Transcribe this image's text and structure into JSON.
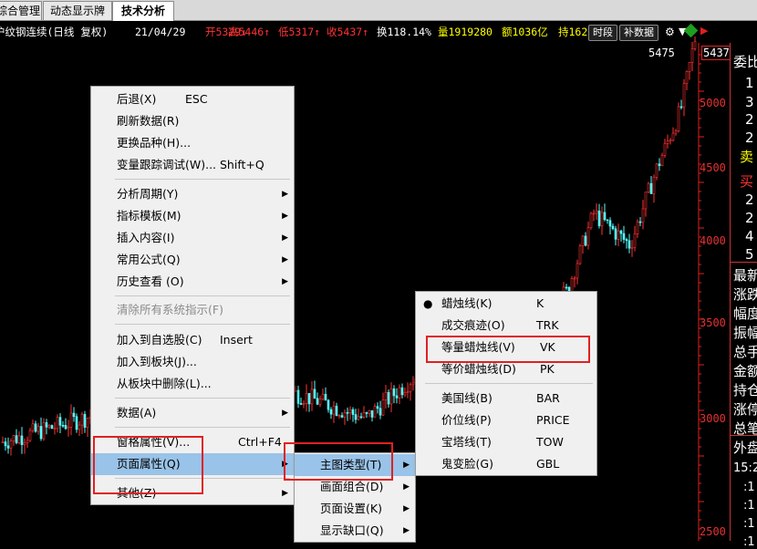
{
  "tabs": [
    {
      "label": "综合管理"
    },
    {
      "label": "动态显示牌"
    },
    {
      "label": "技术分析",
      "active": true
    }
  ],
  "infobar": {
    "name": "沪纹钢连续(日线 复权)",
    "date": "21/04/29",
    "open": "开5329↓",
    "high": "高5446↑",
    "low": "低5317↑",
    "close": "收5437↑",
    "change": "换118.14%",
    "volume": "量1919280",
    "amount": "额1036亿",
    "position": "持162",
    "btn_time": "时段",
    "btn_data": "补数据"
  },
  "chart": {
    "peak_label": "5475",
    "last_price": "5437",
    "price_axis": [
      "5000",
      "4500",
      "4000",
      "3500",
      "3000",
      "2500"
    ],
    "colors": {
      "up": "#ff3232",
      "down": "#54ffff",
      "axis": "#e02020"
    }
  },
  "right_panel": {
    "header": "委比",
    "sell_rows": [
      "1",
      "3",
      "2",
      "2"
    ],
    "sell_label": "卖",
    "buy_label": "买",
    "buy_rows": [
      "2",
      "2",
      "4",
      "5"
    ],
    "info_labels": [
      "最新",
      "涨跌",
      "幅度",
      "振幅",
      "总手",
      "金额",
      "持仓",
      "涨停",
      "总笔"
    ],
    "outer_label": "外盘",
    "time": "15:2",
    "ticks": [
      ":1",
      ":1",
      ":1",
      ":1"
    ]
  },
  "context_menu": {
    "items": [
      {
        "label": "后退(X)",
        "shortcut": "ESC"
      },
      {
        "label": "刷新数据(R)"
      },
      {
        "label": "更换品种(H)..."
      },
      {
        "label": "变量跟踪调试(W)...",
        "shortcut": "Shift+Q"
      },
      {
        "label": "分析周期(Y)",
        "submenu": true
      },
      {
        "label": "指标模板(M)",
        "submenu": true
      },
      {
        "label": "插入内容(I)",
        "submenu": true
      },
      {
        "label": "常用公式(Q)",
        "submenu": true
      },
      {
        "label": "历史查看 (O)",
        "submenu": true
      },
      {
        "label": "清除所有系统指示(F)",
        "disabled": true
      },
      {
        "label": "加入到自选股(C)",
        "shortcut": "Insert"
      },
      {
        "label": "加入到板块(J)..."
      },
      {
        "label": "从板块中删除(L)..."
      },
      {
        "label": "数据(A)",
        "submenu": true
      },
      {
        "label": "窗格属性(V)...",
        "shortcut": "Ctrl+F4"
      },
      {
        "label": "页面属性(Q)",
        "submenu": true,
        "highlighted": true
      },
      {
        "label": "其他(Z)",
        "submenu": true
      }
    ]
  },
  "page_menu": {
    "items": [
      {
        "label": "主图类型(T)",
        "submenu": true,
        "highlighted": true
      },
      {
        "label": "画面组合(D)",
        "submenu": true
      },
      {
        "label": "页面设置(K)",
        "submenu": true
      },
      {
        "label": "显示缺口(Q)",
        "submenu": true
      }
    ]
  },
  "chart_type_menu": {
    "items": [
      {
        "label": "蜡烛线(K)",
        "shortcut": "K",
        "checked": true
      },
      {
        "label": "成交痕迹(O)",
        "shortcut": "TRK"
      },
      {
        "label": "等量蜡烛线(V)",
        "shortcut": "VK"
      },
      {
        "label": "等价蜡烛线(D)",
        "shortcut": "PK"
      },
      {
        "label": "美国线(B)",
        "shortcut": "BAR"
      },
      {
        "label": "价位线(P)",
        "shortcut": "PRICE"
      },
      {
        "label": "宝塔线(T)",
        "shortcut": "TOW"
      },
      {
        "label": "鬼变脸(G)",
        "shortcut": "GBL"
      }
    ]
  }
}
